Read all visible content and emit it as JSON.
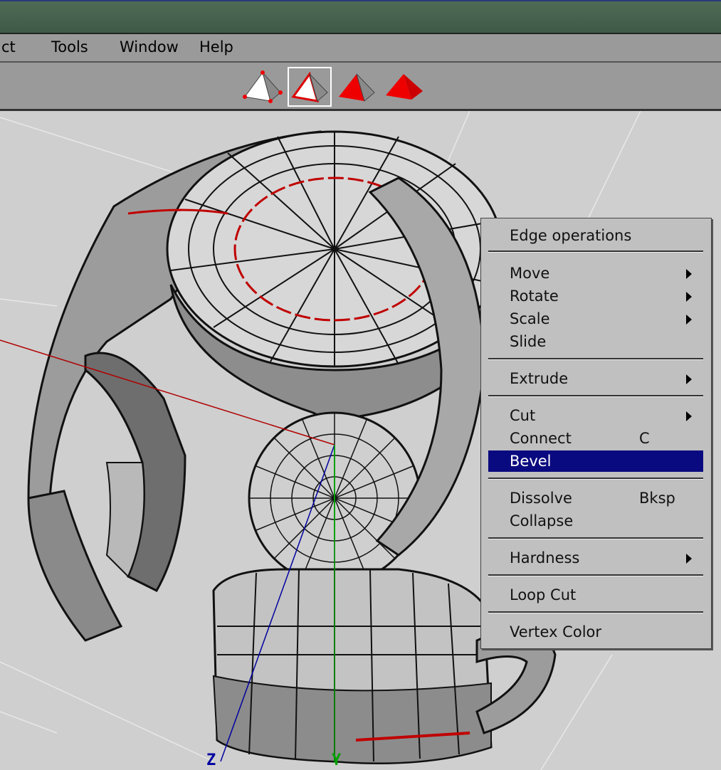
{
  "menubar": {
    "items": [
      {
        "label": "ct"
      },
      {
        "label": "Tools"
      },
      {
        "label": "Window"
      },
      {
        "label": "Help"
      }
    ]
  },
  "toolbar": {
    "buttons": [
      {
        "icon": "vertex-select-icon",
        "active": false
      },
      {
        "icon": "edge-select-icon",
        "active": true
      },
      {
        "icon": "face-select-icon",
        "active": false
      },
      {
        "icon": "body-select-icon",
        "active": false
      }
    ]
  },
  "context_menu": {
    "title": "Edge operations",
    "items": [
      {
        "label": "Move",
        "shortcut": "",
        "submenu": true
      },
      {
        "label": "Rotate",
        "shortcut": "",
        "submenu": true
      },
      {
        "label": "Scale",
        "shortcut": "",
        "submenu": true
      },
      {
        "label": "Slide",
        "shortcut": "",
        "submenu": false
      },
      {
        "label": "Extrude",
        "shortcut": "",
        "submenu": true
      },
      {
        "label": "Cut",
        "shortcut": "",
        "submenu": true
      },
      {
        "label": "Connect",
        "shortcut": "C",
        "submenu": false
      },
      {
        "label": "Bevel",
        "shortcut": "",
        "submenu": false,
        "highlighted": true
      },
      {
        "label": "Dissolve",
        "shortcut": "Bksp",
        "submenu": false
      },
      {
        "label": "Collapse",
        "shortcut": "",
        "submenu": false
      },
      {
        "label": "Hardness",
        "shortcut": "",
        "submenu": true
      },
      {
        "label": "Loop Cut",
        "shortcut": "",
        "submenu": false
      },
      {
        "label": "Vertex Color",
        "shortcut": "",
        "submenu": false
      }
    ]
  },
  "viewport": {
    "axis_labels": {
      "z": "Z",
      "y": "Y"
    },
    "colors": {
      "x_axis": "#b00000",
      "y_axis": "#00a000",
      "z_axis": "#0000a0",
      "selected_edge": "#c00000",
      "highlight": "#0a0a80"
    }
  }
}
